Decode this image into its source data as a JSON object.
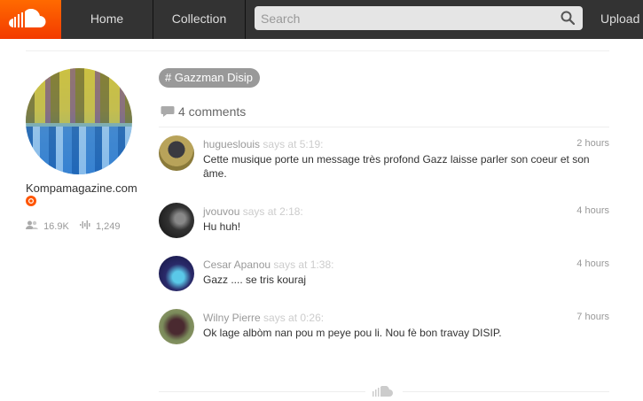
{
  "header": {
    "nav": {
      "home": "Home",
      "collection": "Collection",
      "upload": "Upload"
    },
    "search": {
      "placeholder": "Search",
      "value": ""
    }
  },
  "user": {
    "name": "Kompamagazine.com",
    "followers": "16.9K",
    "tracks": "1,249"
  },
  "tag": {
    "symbol": "#",
    "label": "Gazzman Disip"
  },
  "comments_section": {
    "heading": "4 comments",
    "items": [
      {
        "user": "hugueslouis",
        "says": "says at 5:19:",
        "time": "2 hours",
        "text": "Cette musique porte un message très profond Gazz laisse parler son coeur et son âme."
      },
      {
        "user": "jvouvou",
        "says": "says at 2:18:",
        "time": "4 hours",
        "text": "Hu huh!"
      },
      {
        "user": "Cesar Apanou",
        "says": "says at 1:38:",
        "time": "4 hours",
        "text": "Gazz .... se tris kouraj"
      },
      {
        "user": "Wilny Pierre",
        "says": "says at 0:26:",
        "time": "7 hours",
        "text": "Ok lage albòm nan pou m peye pou li. Nou fè bon travay DISIP."
      }
    ]
  },
  "colors": {
    "brand": "#ff5500",
    "header_bg": "#333333",
    "tag_bg": "#999999"
  },
  "icons": [
    "soundcloud-logo-icon",
    "search-icon",
    "pro-star-icon",
    "followers-icon",
    "tracks-icon",
    "comment-icon"
  ]
}
